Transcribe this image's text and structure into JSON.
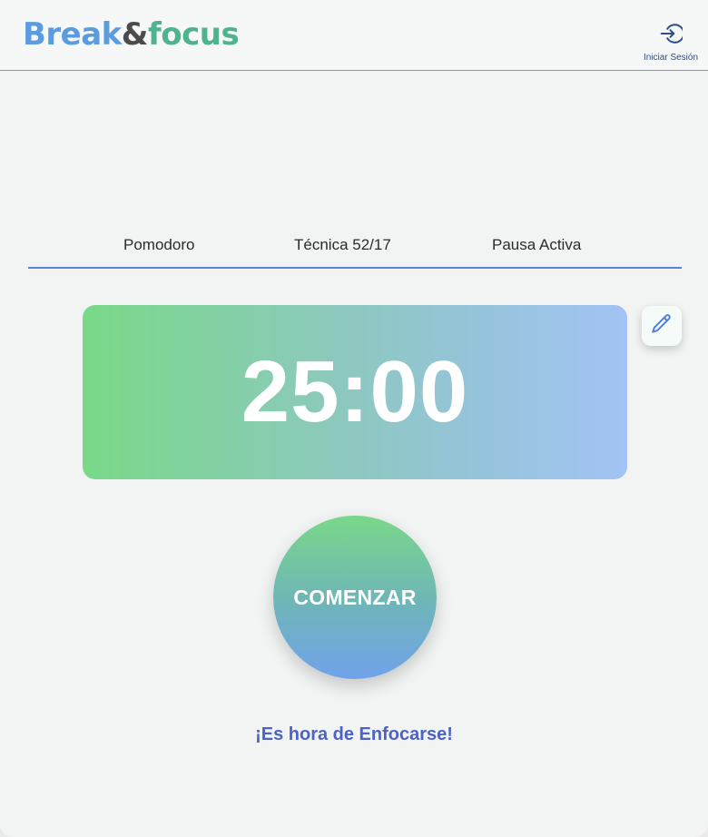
{
  "header": {
    "logo": {
      "part1": "Break",
      "part2": "&",
      "part3": "focus"
    },
    "login": {
      "label": "Iniciar Sesión",
      "icon": "login-icon"
    }
  },
  "tabs": [
    {
      "label": "Pomodoro"
    },
    {
      "label": "Técnica 52/17"
    },
    {
      "label": "Pausa Activa"
    }
  ],
  "timer": {
    "value": "25:00",
    "edit_icon": "pencil-icon"
  },
  "start_button": {
    "label": "COMENZAR"
  },
  "status_message": "¡Es hora de Enfocarse!",
  "colors": {
    "brand_blue": "#5b9be0",
    "brand_green": "#4fb38f",
    "tab_underline": "#5b82d6",
    "message": "#4b63c8"
  }
}
